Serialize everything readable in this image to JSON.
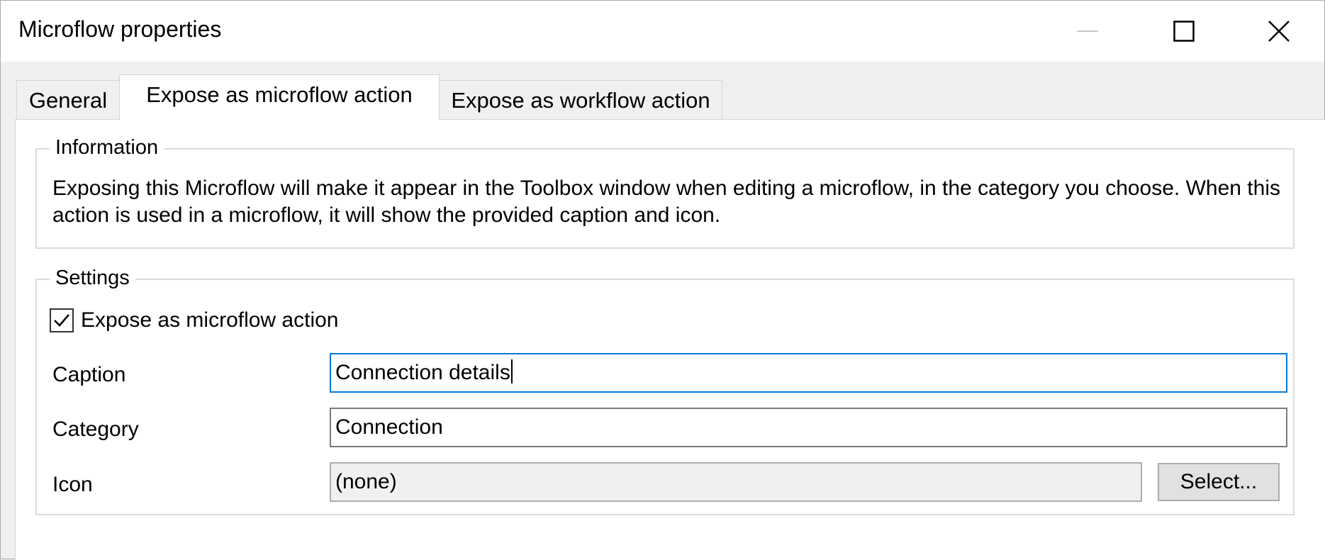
{
  "window": {
    "title": "Microflow properties"
  },
  "tabs": [
    {
      "label": "General",
      "active": false
    },
    {
      "label": "Expose as microflow action",
      "active": true
    },
    {
      "label": "Expose as workflow action",
      "active": false
    }
  ],
  "information": {
    "legend": "Information",
    "text": "Exposing this Microflow will make it appear in the Toolbox window when editing a microflow, in the category you choose. When this action is used in a microflow, it will show the provided caption and icon."
  },
  "settings": {
    "legend": "Settings",
    "expose_checkbox": {
      "label": "Expose as microflow action",
      "checked": true
    },
    "caption": {
      "label": "Caption",
      "value": "Connection details"
    },
    "category": {
      "label": "Category",
      "value": "Connection"
    },
    "icon": {
      "label": "Icon",
      "value": "(none)",
      "select_label": "Select..."
    }
  },
  "colors": {
    "focus_border": "#0078d7",
    "window_background": "#f0f0f0",
    "panel_background": "#ffffff"
  }
}
